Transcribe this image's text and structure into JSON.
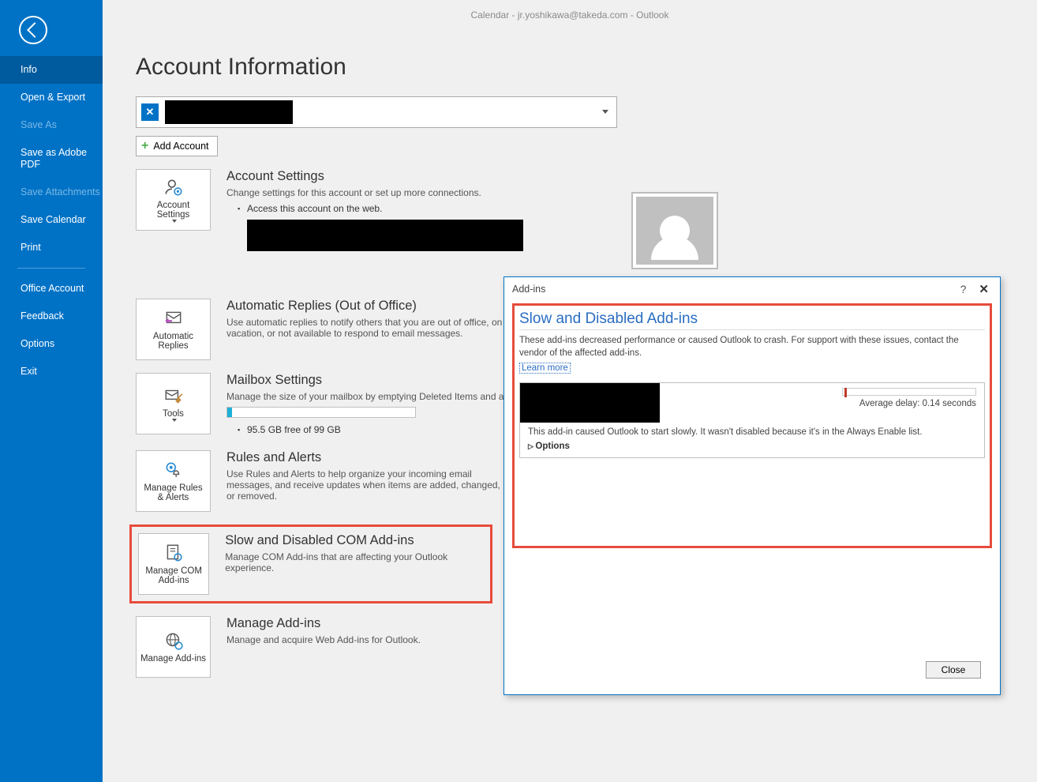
{
  "titlebar": "Calendar - jr.yoshikawa@takeda.com  -  Outlook",
  "sidebar": {
    "items": [
      {
        "label": "Info",
        "state": "selected"
      },
      {
        "label": "Open & Export",
        "state": ""
      },
      {
        "label": "Save As",
        "state": "disabled"
      },
      {
        "label": "Save as Adobe PDF",
        "state": ""
      },
      {
        "label": "Save Attachments",
        "state": "disabled"
      },
      {
        "label": "Save Calendar",
        "state": ""
      },
      {
        "label": "Print",
        "state": ""
      }
    ],
    "items2": [
      {
        "label": "Office Account"
      },
      {
        "label": "Feedback"
      },
      {
        "label": "Options"
      },
      {
        "label": "Exit"
      }
    ]
  },
  "page": {
    "title": "Account Information",
    "add_account": "Add Account"
  },
  "sections": {
    "acct": {
      "tile": "Account Settings",
      "h": "Account Settings",
      "p": "Change settings for this account or set up more connections.",
      "b1": "Access this account on the web."
    },
    "auto": {
      "tile": "Automatic Replies",
      "h": "Automatic Replies (Out of Office)",
      "p": "Use automatic replies to notify others that you are out of office, on vacation, or not available to respond to email messages."
    },
    "mbox": {
      "tile": "Tools",
      "h": "Mailbox Settings",
      "p": "Manage the size of your mailbox by emptying Deleted Items and archiving.",
      "free": "95.5 GB free of 99 GB"
    },
    "rules": {
      "tile": "Manage Rules & Alerts",
      "h": "Rules and Alerts",
      "p": "Use Rules and Alerts to help organize your incoming email messages, and receive updates when items are added, changed, or removed."
    },
    "com": {
      "tile": "Manage COM Add-ins",
      "h": "Slow and Disabled COM Add-ins",
      "p": "Manage COM Add-ins that are affecting your Outlook experience."
    },
    "web": {
      "tile": "Manage Add-ins",
      "h": "Manage Add-ins",
      "p": "Manage and acquire Web Add-ins for Outlook."
    }
  },
  "dialog": {
    "title": "Add-ins",
    "heading": "Slow and Disabled Add-ins",
    "desc": "These add-ins decreased performance or caused Outlook to crash. For support with these issues, contact the vendor of the affected add-ins.",
    "learn": "Learn more",
    "delay": "Average delay: 0.14 seconds",
    "msg": "This add-in caused Outlook to start slowly. It wasn't disabled because it's in the Always Enable list.",
    "options": "Options",
    "close": "Close"
  }
}
